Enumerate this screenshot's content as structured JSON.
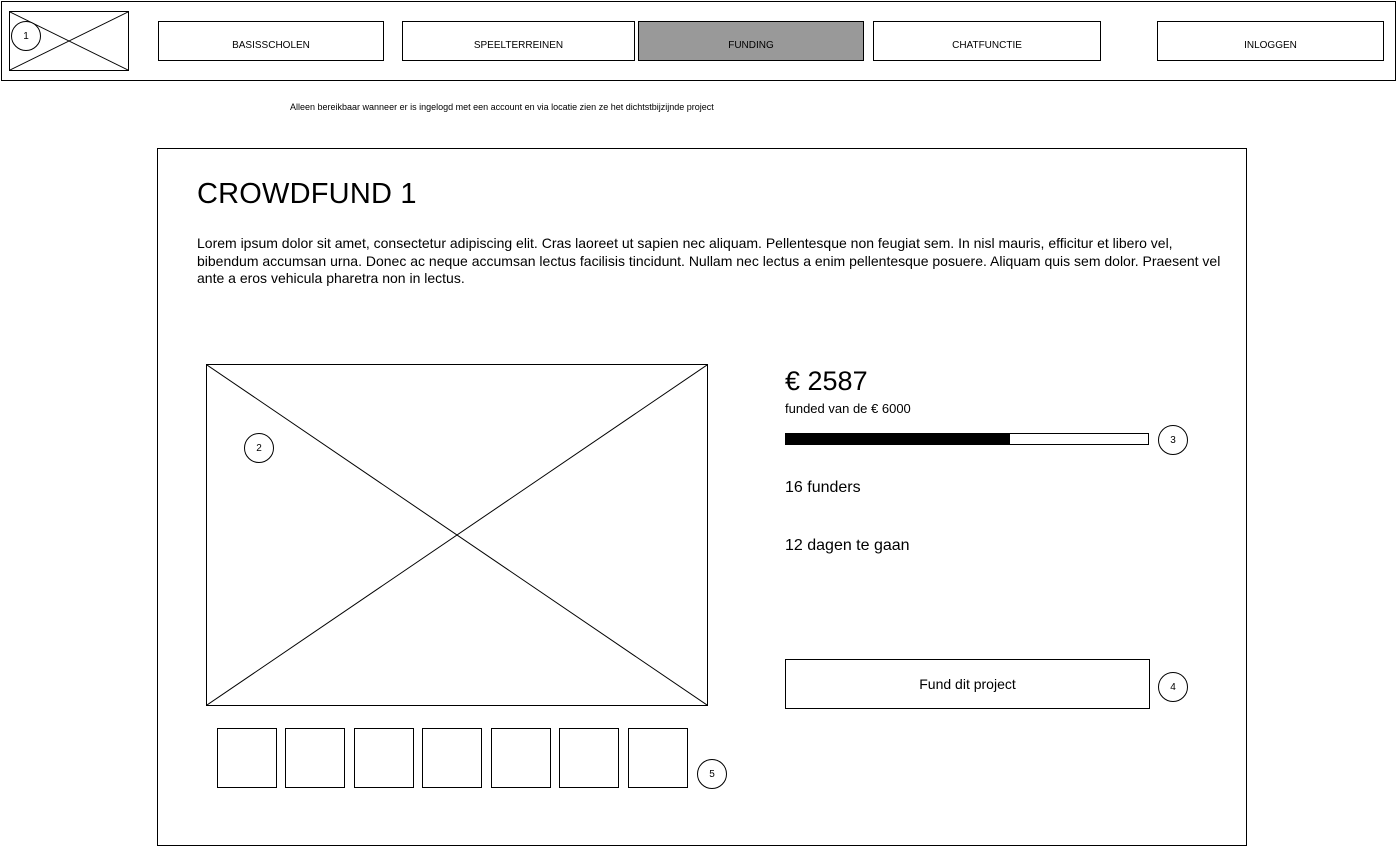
{
  "nav": {
    "items": [
      {
        "label": "BASISSCHOLEN",
        "active": false
      },
      {
        "label": "SPEELTERREINEN",
        "active": false
      },
      {
        "label": "FUNDING",
        "active": true
      },
      {
        "label": "CHATFUNCTIE",
        "active": false
      },
      {
        "label": "INLOGGEN",
        "active": false
      }
    ],
    "logo_icon": "image-placeholder-icon",
    "active_color": "#999999"
  },
  "annotation_note": "Alleen bereikbaar wanneer er is ingelogd met een account en via locatie zien ze het dichtstbijzijnde project",
  "markers": [
    "1",
    "2",
    "3",
    "4",
    "5"
  ],
  "project": {
    "title": "CROWDFUND 1",
    "description": "Lorem ipsum dolor sit amet, consectetur adipiscing elit. Cras laoreet ut sapien nec aliquam. Pellentesque non feugiat sem. In nisl mauris, efficitur et libero vel, bibendum accumsan urna. Donec ac neque accumsan lectus facilisis tincidunt. Nullam nec lectus a enim pellentesque posuere. Aliquam quis sem dolor. Praesent vel ante a eros vehicula pharetra non in lectus.",
    "main_image_icon": "image-placeholder-icon",
    "thumbnail_count": 7
  },
  "funding": {
    "amount": "€ 2587",
    "goal_text": "funded van de € 6000",
    "progress_fraction": 0.62,
    "funders": "16 funders",
    "days_left": "12 dagen te gaan",
    "button_label": "Fund dit project"
  }
}
